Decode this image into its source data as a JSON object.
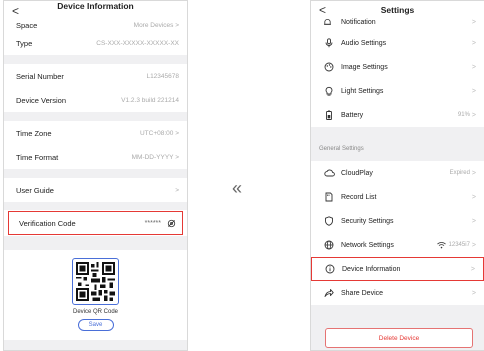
{
  "left": {
    "back": "<",
    "title": "Device Information",
    "space": {
      "label": "Space",
      "value": "More Devices",
      "chev": ">"
    },
    "type": {
      "label": "Type",
      "value": "CS-XXX-XXXXX-XXXXX-XX"
    },
    "serial": {
      "label": "Serial Number",
      "value": "L12345678"
    },
    "version": {
      "label": "Device Version",
      "value": "V1.2.3 build 221214"
    },
    "timezone": {
      "label": "Time Zone",
      "value": "UTC+08:00",
      "chev": ">"
    },
    "timeformat": {
      "label": "Time Format",
      "value": "MM-DD-YYYY",
      "chev": ">"
    },
    "guide": {
      "label": "User Guide",
      "chev": ">"
    },
    "verify": {
      "label": "Verification Code",
      "value": "******"
    },
    "qr_caption": "Device QR Code",
    "save": "Save"
  },
  "arrow": "«",
  "right": {
    "back": "<",
    "title": "Settings",
    "notification": "Notification",
    "audio": "Audio Settings",
    "image": "Image Settings",
    "light": "Light Settings",
    "battery": {
      "label": "Battery",
      "value": "91%"
    },
    "general": "General Settings",
    "cloud": {
      "label": "CloudPlay",
      "value": "Expired"
    },
    "record": "Record List",
    "security": "Security Settings",
    "network": {
      "label": "Network Settings",
      "value": "12345i7"
    },
    "devinfo": "Device Information",
    "share": "Share Device",
    "delete": "Delete Device",
    "chev": ">"
  },
  "colors": {
    "accent": "#4a6fd8",
    "highlight": "#e53935"
  }
}
